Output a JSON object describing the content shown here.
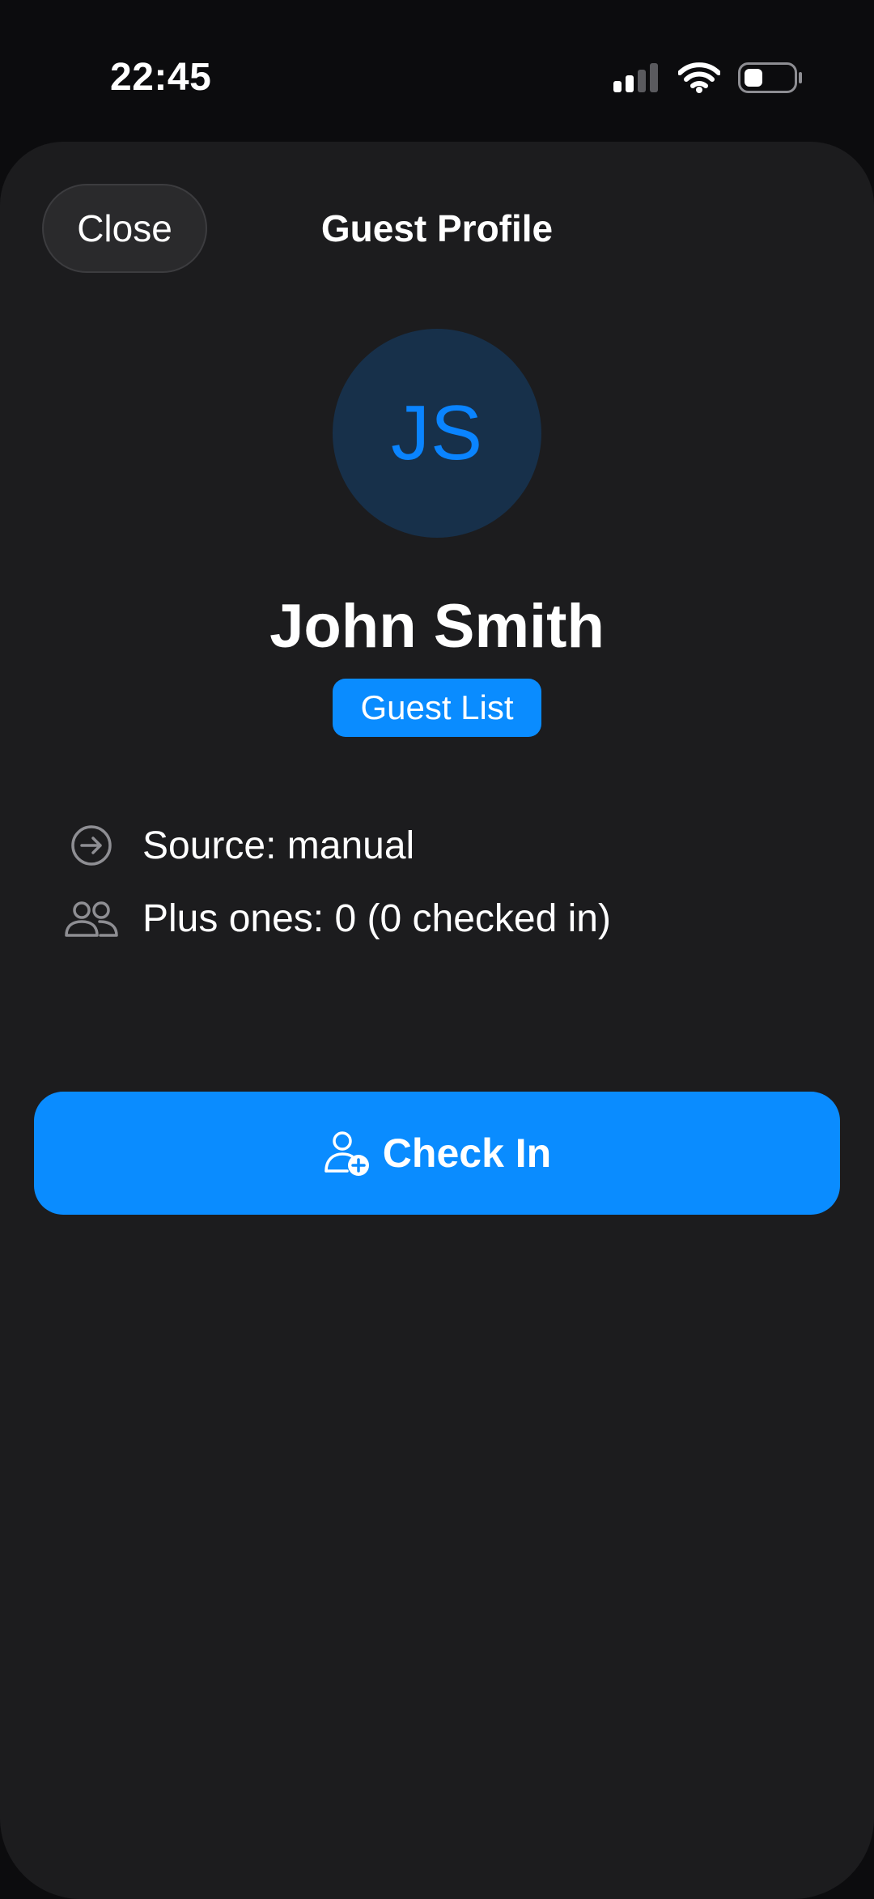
{
  "status_bar": {
    "time": "22:45",
    "icons": [
      "cellular-signal-icon",
      "wifi-icon",
      "battery-icon"
    ]
  },
  "sheet": {
    "title": "Guest Profile",
    "close_label": "Close"
  },
  "guest": {
    "initials": "JS",
    "name": "John Smith",
    "badge": "Guest List"
  },
  "details": {
    "source": "Source: manual",
    "plus_ones": "Plus ones: 0 (0 checked in)"
  },
  "actions": {
    "check_in_label": "Check In"
  },
  "colors": {
    "accent": "#0a8cff",
    "background": "#1c1c1e",
    "avatar_bg": "#17304a",
    "icon_gray": "#8e8e93"
  }
}
